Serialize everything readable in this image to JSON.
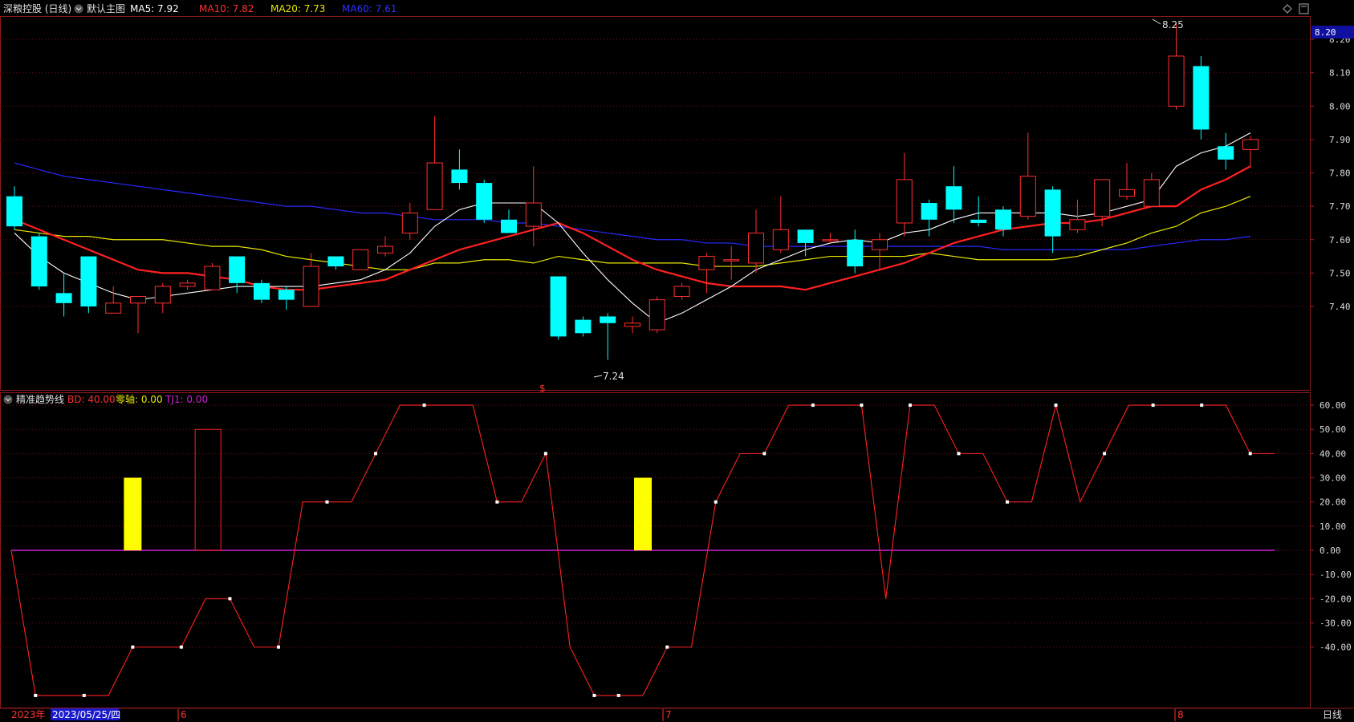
{
  "header": {
    "stock_name": "深粮控股 (日线)",
    "main_chart_label": "默认主图",
    "ma5": "MA5: 7.92",
    "ma10": "MA10: 7.82",
    "ma20": "MA20: 7.73",
    "ma60": "MA60: 7.61",
    "colors": {
      "ma5": "#ffffff",
      "ma10": "#ff3030",
      "ma20": "#e8e800",
      "ma60": "#2828ff"
    }
  },
  "sub_header": {
    "indicator_name": "精准趋势线",
    "bd": "BD: 40.00",
    "zero_axis": "零轴: 0.00",
    "tj1": "TJ1: 0.00"
  },
  "footer": {
    "year": "2023年",
    "cursor_date": "2023/05/25/四",
    "month_6": "6",
    "month_7": "7",
    "month_8": "8",
    "period": "日线"
  },
  "chart_data": [
    {
      "type": "candlestick",
      "ylim": [
        7.15,
        8.27
      ],
      "y_ticks": [
        "8.20",
        "8.10",
        "8.00",
        "7.90",
        "7.80",
        "7.70",
        "7.60",
        "7.50",
        "7.40"
      ],
      "current_price_label": "8.20",
      "high_marker": "8.25",
      "low_marker": "7.24",
      "ex_marker": "$",
      "candles": [
        [
          7.73,
          7.64,
          7.76,
          7.63
        ],
        [
          7.61,
          7.46,
          7.62,
          7.45
        ],
        [
          7.44,
          7.41,
          7.5,
          7.37
        ],
        [
          7.55,
          7.4,
          7.55,
          7.38
        ],
        [
          7.38,
          7.41,
          7.46,
          7.38
        ],
        [
          7.41,
          7.43,
          7.43,
          7.32
        ],
        [
          7.41,
          7.46,
          7.47,
          7.38
        ],
        [
          7.46,
          7.47,
          7.48,
          7.45
        ],
        [
          7.45,
          7.52,
          7.53,
          7.45
        ],
        [
          7.55,
          7.47,
          7.55,
          7.44
        ],
        [
          7.47,
          7.42,
          7.48,
          7.41
        ],
        [
          7.45,
          7.42,
          7.46,
          7.39
        ],
        [
          7.4,
          7.52,
          7.56,
          7.4
        ],
        [
          7.55,
          7.52,
          7.55,
          7.51
        ],
        [
          7.51,
          7.57,
          7.57,
          7.51
        ],
        [
          7.56,
          7.58,
          7.61,
          7.55
        ],
        [
          7.62,
          7.68,
          7.71,
          7.6
        ],
        [
          7.69,
          7.83,
          7.97,
          7.69
        ],
        [
          7.81,
          7.77,
          7.87,
          7.75
        ],
        [
          7.77,
          7.66,
          7.78,
          7.65
        ],
        [
          7.66,
          7.62,
          7.69,
          7.62
        ],
        [
          7.64,
          7.71,
          7.82,
          7.58
        ],
        [
          7.49,
          7.31,
          7.49,
          7.3
        ],
        [
          7.36,
          7.32,
          7.37,
          7.31
        ],
        [
          7.37,
          7.35,
          7.38,
          7.24
        ],
        [
          7.34,
          7.35,
          7.37,
          7.32
        ],
        [
          7.33,
          7.42,
          7.43,
          7.32
        ],
        [
          7.43,
          7.46,
          7.47,
          7.42
        ],
        [
          7.51,
          7.55,
          7.56,
          7.44
        ],
        [
          7.54,
          7.54,
          7.58,
          7.48
        ],
        [
          7.53,
          7.62,
          7.69,
          7.5
        ],
        [
          7.57,
          7.63,
          7.73,
          7.56
        ],
        [
          7.63,
          7.59,
          7.63,
          7.55
        ],
        [
          7.6,
          7.6,
          7.62,
          7.59
        ],
        [
          7.6,
          7.52,
          7.63,
          7.5
        ],
        [
          7.57,
          7.6,
          7.62,
          7.51
        ],
        [
          7.65,
          7.78,
          7.86,
          7.61
        ],
        [
          7.71,
          7.66,
          7.72,
          7.61
        ],
        [
          7.76,
          7.69,
          7.82,
          7.65
        ],
        [
          7.66,
          7.65,
          7.73,
          7.64
        ],
        [
          7.69,
          7.63,
          7.7,
          7.61
        ],
        [
          7.67,
          7.79,
          7.92,
          7.66
        ],
        [
          7.75,
          7.61,
          7.76,
          7.56
        ],
        [
          7.63,
          7.66,
          7.72,
          7.62
        ],
        [
          7.67,
          7.78,
          7.78,
          7.64
        ],
        [
          7.73,
          7.75,
          7.83,
          7.72
        ],
        [
          7.7,
          7.78,
          7.8,
          7.7
        ],
        [
          8.0,
          8.15,
          8.25,
          7.99
        ],
        [
          8.12,
          7.93,
          8.15,
          7.9
        ],
        [
          7.88,
          7.84,
          7.92,
          7.81
        ],
        [
          7.87,
          7.9,
          7.91,
          7.82
        ]
      ],
      "ma5": [
        7.62,
        7.55,
        7.5,
        7.47,
        7.44,
        7.42,
        7.43,
        7.44,
        7.45,
        7.46,
        7.46,
        7.46,
        7.46,
        7.47,
        7.48,
        7.51,
        7.56,
        7.64,
        7.69,
        7.71,
        7.71,
        7.71,
        7.65,
        7.56,
        7.48,
        7.41,
        7.35,
        7.38,
        7.42,
        7.46,
        7.51,
        7.54,
        7.57,
        7.59,
        7.6,
        7.59,
        7.62,
        7.63,
        7.66,
        7.68,
        7.68,
        7.68,
        7.68,
        7.67,
        7.68,
        7.7,
        7.72,
        7.82,
        7.86,
        7.88,
        7.92
      ],
      "ma10": [
        7.66,
        7.63,
        7.6,
        7.57,
        7.54,
        7.51,
        7.5,
        7.5,
        7.49,
        7.48,
        7.46,
        7.45,
        7.45,
        7.46,
        7.47,
        7.48,
        7.51,
        7.54,
        7.57,
        7.59,
        7.61,
        7.63,
        7.65,
        7.62,
        7.58,
        7.54,
        7.51,
        7.49,
        7.47,
        7.46,
        7.46,
        7.46,
        7.45,
        7.47,
        7.49,
        7.51,
        7.53,
        7.56,
        7.59,
        7.61,
        7.63,
        7.64,
        7.65,
        7.65,
        7.66,
        7.68,
        7.7,
        7.7,
        7.75,
        7.78,
        7.82
      ],
      "ma20": [
        7.63,
        7.62,
        7.61,
        7.61,
        7.6,
        7.6,
        7.6,
        7.59,
        7.58,
        7.58,
        7.57,
        7.55,
        7.54,
        7.53,
        7.52,
        7.51,
        7.51,
        7.53,
        7.53,
        7.54,
        7.54,
        7.53,
        7.55,
        7.54,
        7.53,
        7.53,
        7.53,
        7.53,
        7.52,
        7.52,
        7.52,
        7.53,
        7.54,
        7.55,
        7.55,
        7.55,
        7.55,
        7.56,
        7.55,
        7.54,
        7.54,
        7.54,
        7.54,
        7.55,
        7.57,
        7.59,
        7.62,
        7.64,
        7.68,
        7.7,
        7.73
      ],
      "ma60": [
        7.83,
        7.81,
        7.79,
        7.78,
        7.77,
        7.76,
        7.75,
        7.74,
        7.73,
        7.72,
        7.71,
        7.7,
        7.7,
        7.69,
        7.68,
        7.68,
        7.67,
        7.66,
        7.66,
        7.66,
        7.65,
        7.65,
        7.64,
        7.63,
        7.62,
        7.61,
        7.6,
        7.6,
        7.59,
        7.59,
        7.58,
        7.58,
        7.58,
        7.58,
        7.58,
        7.58,
        7.58,
        7.58,
        7.58,
        7.58,
        7.57,
        7.57,
        7.57,
        7.57,
        7.57,
        7.57,
        7.58,
        7.59,
        7.6,
        7.6,
        7.61
      ]
    },
    {
      "type": "line",
      "name": "精准趋势线",
      "ylim": [
        -65,
        65
      ],
      "y_ticks": [
        "60.00",
        "50.00",
        "40.00",
        "30.00",
        "20.00",
        "10.00",
        "0.00",
        "-10.00",
        "-20.00",
        "-30.00",
        "-40.00"
      ],
      "line_values": [
        0,
        -60,
        -60,
        -60,
        -60,
        -40,
        -40,
        -40,
        -20,
        -20,
        -40,
        -40,
        20,
        20,
        20,
        40,
        60,
        60,
        60,
        60,
        20,
        20,
        40,
        -40,
        -60,
        -60,
        -60,
        -40,
        -40,
        20,
        40,
        40,
        60,
        60,
        60,
        60,
        -20,
        60,
        60,
        40,
        40,
        20,
        20,
        60,
        20,
        40,
        60,
        60,
        60,
        60,
        60,
        40,
        40
      ],
      "yellow_bars": [
        {
          "index": 5,
          "value": 30
        },
        {
          "index": 26,
          "value": 30
        }
      ],
      "red_box": {
        "index": 8,
        "value": 50
      },
      "marked_points": [
        1,
        3,
        5,
        7,
        9,
        11,
        13,
        15,
        17,
        20,
        22,
        24,
        25,
        27,
        29,
        31,
        33,
        35,
        37,
        39,
        41,
        43,
        45,
        47,
        49,
        51
      ],
      "magenta_baseline": 0
    }
  ]
}
